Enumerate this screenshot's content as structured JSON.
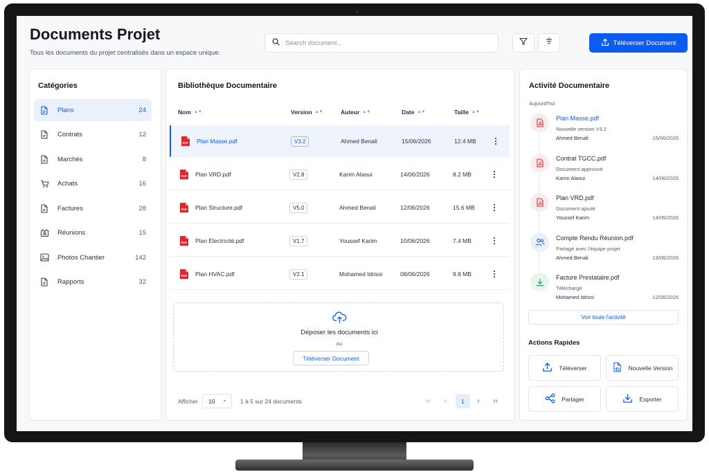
{
  "header": {
    "title": "Documents Projet",
    "subtitle": "Tous les documents du projet centralisés dans un espace unique.",
    "search_placeholder": "Search document...",
    "upload_label": "Téléverser Document",
    "icons": [
      "search-icon",
      "filter-icon",
      "sort-icon",
      "upload-icon"
    ]
  },
  "categories": {
    "title": "Catégories",
    "items": [
      {
        "label": "Plans",
        "count": "24",
        "icon": "file-icon",
        "active": true
      },
      {
        "label": "Contrats",
        "count": "12",
        "icon": "file-icon"
      },
      {
        "label": "Marchés",
        "count": "8",
        "icon": "file-icon"
      },
      {
        "label": "Achats",
        "count": "16",
        "icon": "cart-icon"
      },
      {
        "label": "Factures",
        "count": "28",
        "icon": "file-icon"
      },
      {
        "label": "Réunions",
        "count": "15",
        "icon": "meeting-icon"
      },
      {
        "label": "Photos Chantier",
        "count": "142",
        "icon": "image-icon"
      },
      {
        "label": "Rapports",
        "count": "32",
        "icon": "file-icon"
      }
    ]
  },
  "library": {
    "title": "Bibliothèque Documentaire",
    "columns": [
      "Nom",
      "Version",
      "Auteur",
      "Date",
      "Taille"
    ],
    "rows": [
      {
        "name": "Plan Masse.pdf",
        "version": "V3.2",
        "author": "Ahmed Benali",
        "date": "15/06/2026",
        "size": "12.4 MB",
        "selected": true
      },
      {
        "name": "Plan VRD.pdf",
        "version": "V2.8",
        "author": "Karim Alaoui",
        "date": "14/06/2026",
        "size": "8.2 MB"
      },
      {
        "name": "Plan Structure.pdf",
        "version": "V5.0",
        "author": "Ahmed Benali",
        "date": "12/06/2026",
        "size": "15.6 MB"
      },
      {
        "name": "Plan Électricité.pdf",
        "version": "V1.7",
        "author": "Youssef Karim",
        "date": "10/06/2026",
        "size": "7.4 MB"
      },
      {
        "name": "Plan HVAC.pdf",
        "version": "V2.1",
        "author": "Mohamed Idrissi",
        "date": "08/06/2026",
        "size": "9.8 MB"
      }
    ],
    "file_badge": "PDF",
    "dropzone": {
      "title": "Déposer les documents ici",
      "or": "ou",
      "button": "Téléverser Document"
    },
    "pagination": {
      "show_label": "Afficher",
      "page_size": "10",
      "range": "1 à 5 sur 24 documents",
      "current_page": "1",
      "first": "‹‹",
      "prev": "‹",
      "next": "›",
      "last": "››"
    }
  },
  "activity": {
    "title": "Activité Documentaire",
    "day": "Aujourd'hui",
    "items": [
      {
        "title": "Plan Masse.pdf",
        "desc": "Nouvelle version V3.2",
        "user": "Ahmed Benali",
        "date": "15/06/2026",
        "icon": "pdf-icon",
        "tone": "red",
        "link": true
      },
      {
        "title": "Contrat TGCC.pdf",
        "desc": "Document approuvé",
        "user": "Karim Alaoui",
        "date": "14/06/2026",
        "icon": "pdf-icon",
        "tone": "red"
      },
      {
        "title": "Plan VRD.pdf",
        "desc": "Document ajouté",
        "user": "Youssef Karim",
        "date": "14/06/2026",
        "icon": "pdf-icon",
        "tone": "red"
      },
      {
        "title": "Compte Rendu Réunion.pdf",
        "desc": "Partagé avec l'équipe projet",
        "user": "Ahmed Benali",
        "date": "13/06/2026",
        "icon": "users-icon",
        "tone": "blue"
      },
      {
        "title": "Facture Prestataire.pdf",
        "desc": "Téléchargé",
        "user": "Mohamed Idrissi",
        "date": "12/06/2026",
        "icon": "download-icon",
        "tone": "green"
      }
    ],
    "see_all": "Voir toute l'activité",
    "quick_actions_title": "Actions Rapides",
    "quick_actions": [
      {
        "label": "Téléverser",
        "icon": "upload-icon"
      },
      {
        "label": "Nouvelle Version",
        "icon": "new-version-icon"
      },
      {
        "label": "Partager",
        "icon": "share-icon"
      },
      {
        "label": "Exporter",
        "icon": "export-icon"
      }
    ]
  },
  "colors": {
    "accent": "#0b5cf0",
    "pdf_red": "#e0262b",
    "green": "#1f9d55"
  }
}
